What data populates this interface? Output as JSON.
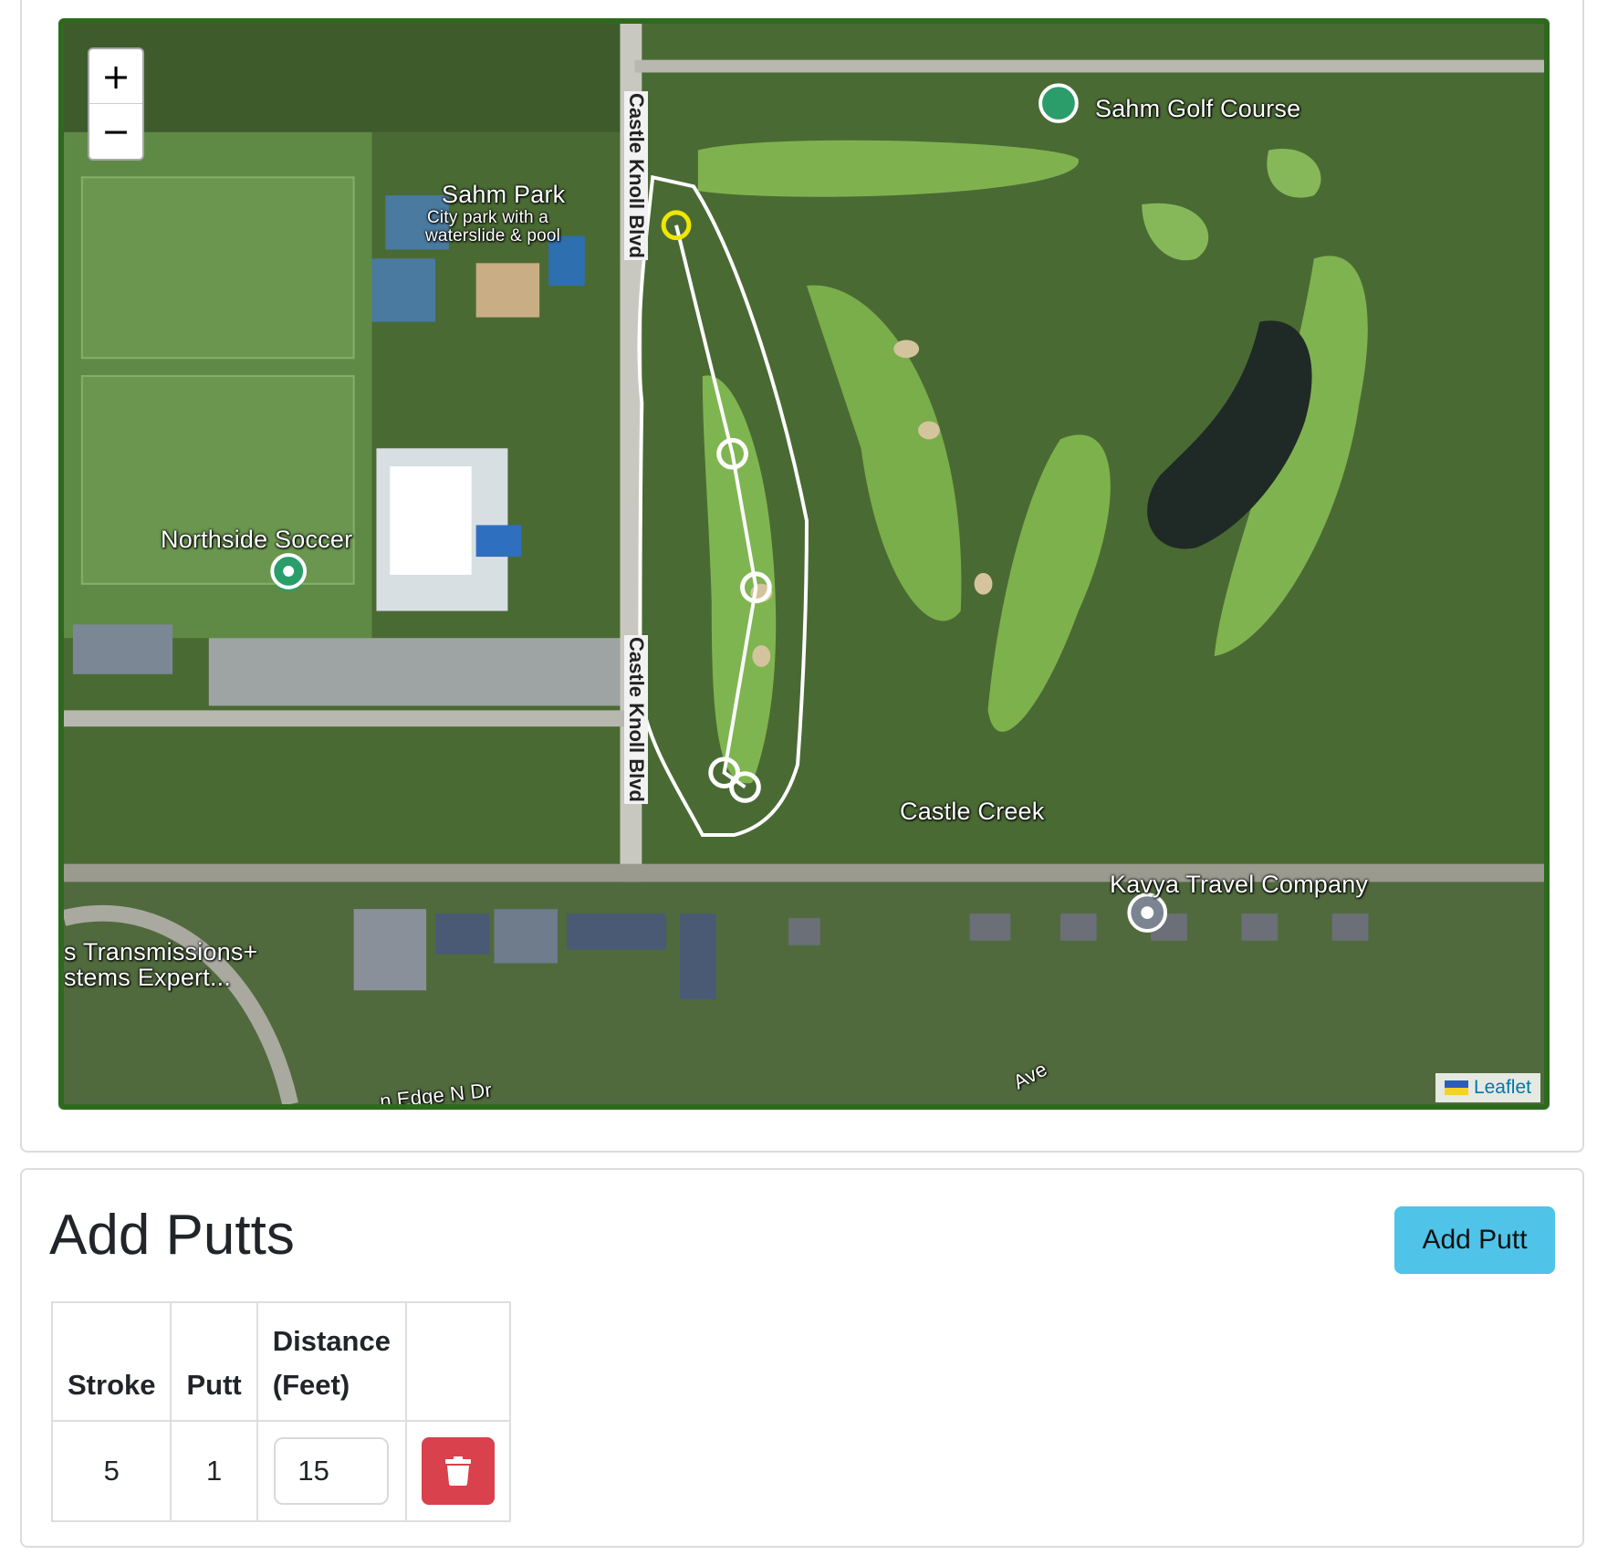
{
  "map": {
    "zoom_in": "+",
    "zoom_out": "−",
    "labels": {
      "park_title": "Sahm Park",
      "park_sub1": "City park with a",
      "park_sub2": "waterslide & pool",
      "golf_course": "Sahm Golf Course",
      "soccer": "Northside Soccer",
      "creek": "Castle Creek",
      "travel": "Kavya Travel Company",
      "road_top": "Castle Knoll Blvd",
      "road_bottom": "Castle Knoll Blvd",
      "transmissions1": "s Transmissions+",
      "transmissions2": "stems Expert...",
      "street_bottom": "n Edge N Dr",
      "street_ave": "Ave"
    },
    "attribution": "Leaflet",
    "colors": {
      "frame": "#2e6a1e",
      "tee_marker": "#f2e600",
      "shot_marker": "#ffffff"
    }
  },
  "putts": {
    "title": "Add Putts",
    "add_button": "Add Putt",
    "headers": {
      "stroke": "Stroke",
      "putt": "Putt",
      "distance_line1": "Distance",
      "distance_line2": "(Feet)"
    },
    "rows": [
      {
        "stroke": "5",
        "putt": "1",
        "distance": "15"
      }
    ],
    "delete_icon": "trash-icon"
  }
}
